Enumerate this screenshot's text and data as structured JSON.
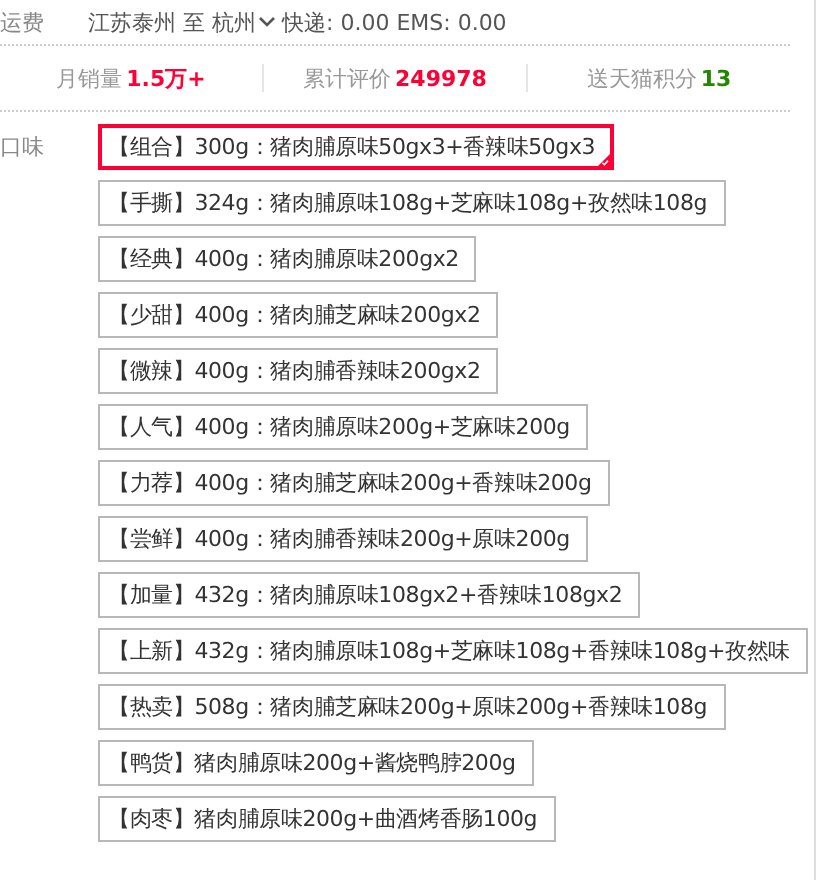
{
  "shipping": {
    "label": "运费",
    "route": "江苏泰州 至 杭州",
    "fees": "快递: 0.00 EMS: 0.00"
  },
  "stats": [
    {
      "label": "月销量",
      "value": "1.5万+",
      "color": "#ff0036"
    },
    {
      "label": "累计评价",
      "value": "249978",
      "color": "#ff0036"
    },
    {
      "label": "送天猫积分",
      "value": "13",
      "color": "#280"
    }
  ],
  "flavor": {
    "label": "口味",
    "options": [
      {
        "text": "【组合】300g：猪肉脯原味50gx3+香辣味50gx3",
        "selected": true
      },
      {
        "text": "【手撕】324g：猪肉脯原味108g+芝麻味108g+孜然味108g",
        "selected": false
      },
      {
        "text": "【经典】400g：猪肉脯原味200gx2",
        "selected": false
      },
      {
        "text": "【少甜】400g：猪肉脯芝麻味200gx2",
        "selected": false
      },
      {
        "text": "【微辣】400g：猪肉脯香辣味200gx2",
        "selected": false
      },
      {
        "text": "【人气】400g：猪肉脯原味200g+芝麻味200g",
        "selected": false
      },
      {
        "text": "【力荐】400g：猪肉脯芝麻味200g+香辣味200g",
        "selected": false
      },
      {
        "text": "【尝鲜】400g：猪肉脯香辣味200g+原味200g",
        "selected": false
      },
      {
        "text": "【加量】432g：猪肉脯原味108gx2+香辣味108gx2",
        "selected": false
      },
      {
        "text": "【上新】432g：猪肉脯原味108g+芝麻味108g+香辣味108g+孜然味",
        "selected": false
      },
      {
        "text": "【热卖】508g：猪肉脯芝麻味200g+原味200g+香辣味108g",
        "selected": false
      },
      {
        "text": "【鸭货】猪肉脯原味200g+酱烧鸭脖200g",
        "selected": false
      },
      {
        "text": "【肉枣】猪肉脯原味200g+曲酒烤香肠100g",
        "selected": false
      }
    ]
  }
}
